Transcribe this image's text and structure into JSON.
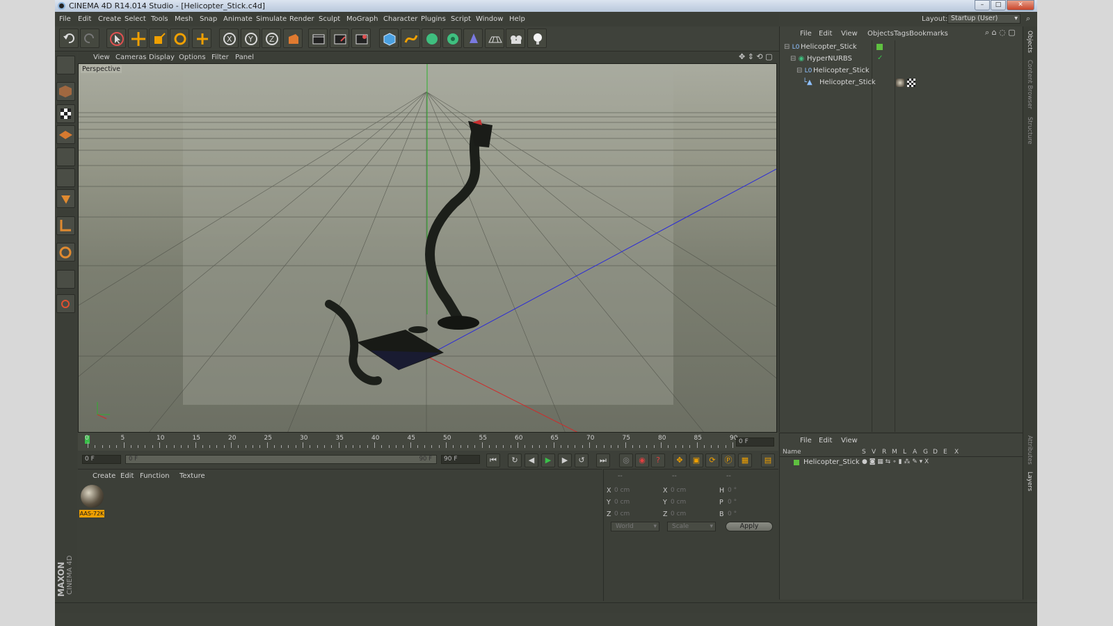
{
  "window": {
    "title": "CINEMA 4D R14.014 Studio - [Helicopter_Stick.c4d]",
    "min_glyph": "–",
    "max_glyph": "□",
    "close_glyph": "✕"
  },
  "menu": [
    "File",
    "Edit",
    "Create",
    "Select",
    "Tools",
    "Mesh",
    "Snap",
    "Animate",
    "Simulate",
    "Render",
    "Sculpt",
    "MoGraph",
    "Character",
    "Plugins",
    "Script",
    "Window",
    "Help"
  ],
  "layout": {
    "label": "Layout:",
    "value": "Startup (User)"
  },
  "viewport": {
    "menu": [
      "View",
      "Cameras",
      "Display",
      "Options",
      "Filter",
      "Panel"
    ],
    "label": "Perspective"
  },
  "timeline": {
    "ticks": [
      "0",
      "5",
      "10",
      "15",
      "20",
      "25",
      "30",
      "35",
      "40",
      "45",
      "50",
      "55",
      "60",
      "65",
      "70",
      "75",
      "80",
      "85",
      "90"
    ],
    "current_frame": "0 F",
    "start_frame": "0 F",
    "range_start": "0 F",
    "range_end": "90 F",
    "end_frame": "90 F"
  },
  "material_panel": {
    "menu": [
      "Create",
      "Edit",
      "Function",
      "Texture"
    ],
    "materials": [
      {
        "name": "AAS-72K"
      }
    ]
  },
  "coordinates": {
    "headers": [
      "--",
      "--",
      "--"
    ],
    "rows": [
      {
        "a": "X",
        "av": "0 cm",
        "b": "X",
        "bv": "0 cm",
        "c": "H",
        "cv": "0 °"
      },
      {
        "a": "Y",
        "av": "0 cm",
        "b": "Y",
        "bv": "0 cm",
        "c": "P",
        "cv": "0 °"
      },
      {
        "a": "Z",
        "av": "0 cm",
        "b": "Z",
        "bv": "0 cm",
        "c": "B",
        "cv": "0 °"
      }
    ],
    "mode": "World",
    "scale": "Scale",
    "apply": "Apply"
  },
  "object_manager": {
    "menu": [
      "File",
      "Edit",
      "View",
      "Objects",
      "Tags",
      "Bookmarks"
    ],
    "objects": [
      {
        "name": "Helicopter_Stick",
        "level": 0,
        "icon": "null-object-icon"
      },
      {
        "name": "HyperNURBS",
        "level": 1,
        "icon": "hypernurbs-icon"
      },
      {
        "name": "Helicopter_Stick",
        "level": 2,
        "icon": "null-object-icon"
      },
      {
        "name": "Helicopter_Stick",
        "level": 3,
        "icon": "polygon-object-icon"
      }
    ]
  },
  "layer_manager": {
    "menu": [
      "File",
      "Edit",
      "View"
    ],
    "columns": [
      "Name",
      "S",
      "V",
      "R",
      "M",
      "L",
      "A",
      "G",
      "D",
      "E",
      "X"
    ],
    "layers": [
      {
        "name": "Helicopter_Stick",
        "color": "#5fc040"
      }
    ]
  },
  "side_tabs": [
    "Objects",
    "Content Browser",
    "Structure"
  ],
  "side_tabs_lower": [
    "Attributes",
    "Layers"
  ],
  "brand": {
    "maxon": "MAXON",
    "product": "CINEMA 4D"
  },
  "colors": {
    "accent": "#f0a000",
    "active_green": "#5fc040",
    "background": "#3c3f38"
  }
}
